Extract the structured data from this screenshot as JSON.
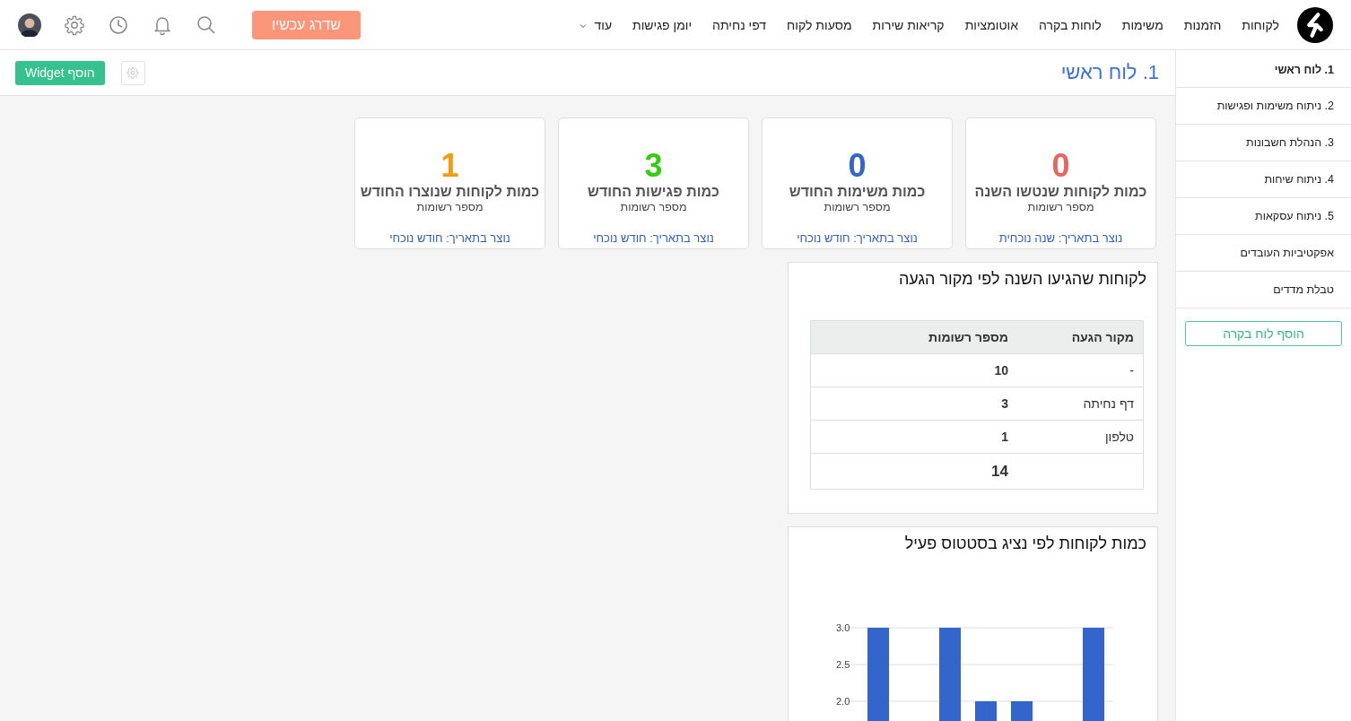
{
  "nav": {
    "items": [
      {
        "label": "לקוחות"
      },
      {
        "label": "הזמנות"
      },
      {
        "label": "משימות"
      },
      {
        "label": "לוחות בקרה"
      },
      {
        "label": "אוטומציות"
      },
      {
        "label": "קריאות שירות"
      },
      {
        "label": "מסעות לקוח"
      },
      {
        "label": "דפי נחיתה"
      },
      {
        "label": "יומן פגישות"
      },
      {
        "label": "עוד",
        "kind": "dropdown"
      }
    ],
    "upgrade_button": "שדרג עכשיו"
  },
  "sidebar": {
    "items": [
      {
        "label": "1. לוח ראשי",
        "selected": true
      },
      {
        "label": "2. ניתוח משימות ופגישות",
        "selected": false
      },
      {
        "label": "3. הנהלת חשבונות",
        "selected": false
      },
      {
        "label": "4. ניתוח שיחות",
        "selected": false
      },
      {
        "label": "5. ניתוח עסקאות",
        "selected": false
      },
      {
        "label": "אפקטיביות העובדים",
        "selected": false
      },
      {
        "label": "טבלת מדדים",
        "selected": false
      }
    ],
    "add_button": "הוסף לוח בקרה"
  },
  "header": {
    "title": "1. לוח ראשי",
    "add_widget_button": "הוסף Widget"
  },
  "stat_cards": [
    {
      "value": "0",
      "color": "#e8665f",
      "title": "כמות לקוחות שנטשו השנה",
      "subtitle": "מספר רשומות",
      "footer": "נוצר בתאריך: שנה נוכחית"
    },
    {
      "value": "0",
      "color": "#3366cc",
      "title": "כמות משימות החודש",
      "subtitle": "מספר רשומות",
      "footer": "נוצר בתאריך: חודש נוכחי"
    },
    {
      "value": "3",
      "color": "#33cc11",
      "title": "כמות פגישות החודש",
      "subtitle": "מספר רשומות",
      "footer": "נוצר בתאריך: חודש נוכחי"
    },
    {
      "value": "1",
      "color": "#f39c12",
      "title": "כמות לקוחות שנוצרו החודש",
      "subtitle": "מספר רשומות",
      "footer": "נוצר בתאריך: חודש נוכחי"
    }
  ],
  "table_widget": {
    "title": "לקוחות שהגיעו השנה לפי מקור הגעה",
    "columns": [
      "מקור הגעה",
      "מספר רשומות"
    ],
    "rows": [
      [
        "-",
        "10"
      ],
      [
        "דף נחיתה",
        "3"
      ],
      [
        "טלפון",
        "1"
      ]
    ],
    "total": "14"
  },
  "chart_widget": {
    "title": "כמות לקוחות לפי נציג בסטטוס פעיל",
    "chart_data": {
      "type": "bar",
      "ylim": [
        0,
        3
      ],
      "yticks": [
        {
          "value": 2,
          "label": "2.0"
        },
        {
          "value": 2.5,
          "label": "2.5"
        },
        {
          "value": 3,
          "label": "3.0"
        }
      ],
      "series": [
        {
          "color": "#3366cc",
          "values": [
            3,
            null,
            3,
            2,
            2,
            null,
            3
          ]
        }
      ]
    }
  }
}
